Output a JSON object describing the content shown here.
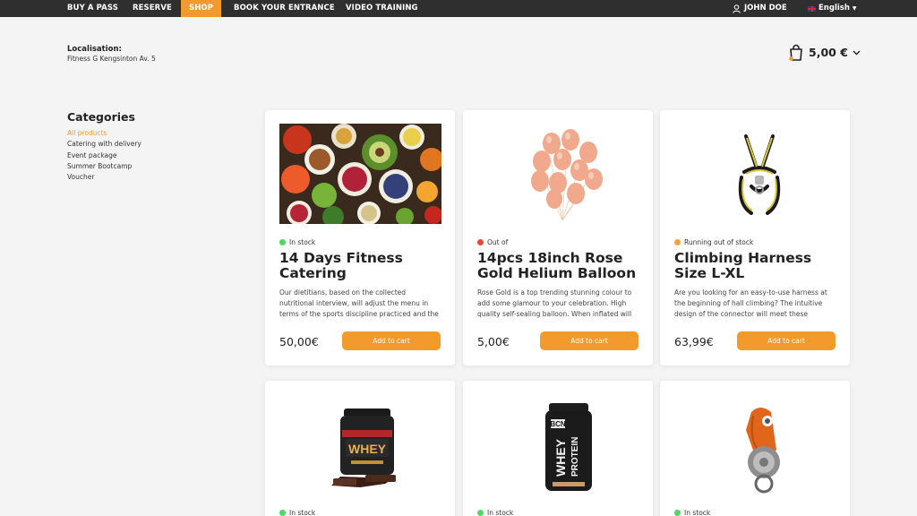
{
  "nav": {
    "items": [
      {
        "label": "BUY A PASS",
        "active": false
      },
      {
        "label": "RESERVE",
        "active": false
      },
      {
        "label": "SHOP",
        "active": true
      },
      {
        "label": "BOOK YOUR ENTRANCE",
        "active": false
      },
      {
        "label": "VIDEO TRAINING",
        "active": false
      }
    ],
    "user": "JOHN DOE",
    "language": "English"
  },
  "localisation": {
    "label": "Localisation:",
    "value": "Fitness G Kengsinton Av. 5"
  },
  "cart": {
    "total": "5,00 €",
    "icon": "shopping-bag-icon"
  },
  "categories": {
    "title": "Categories",
    "items": [
      {
        "label": "All products",
        "active": true
      },
      {
        "label": "Catering with delivery",
        "active": false
      },
      {
        "label": "Event package",
        "active": false
      },
      {
        "label": "Summer Bootcamp",
        "active": false
      },
      {
        "label": "Voucher",
        "active": false
      }
    ]
  },
  "colors": {
    "accent": "#f39a2c",
    "nav_bg": "#2f2f2f",
    "in_stock": "#4cd964",
    "out_of_stock": "#e8473e",
    "running_out": "#f3a23c"
  },
  "products": [
    {
      "stock": "In stock",
      "stock_state": "green",
      "title": "14 Days Fitness Catering",
      "description": "Our dietitians, based on the collected nutritional interview, will adjust the menu in terms of the sports discipline practiced and the needs.",
      "price": "50,00€",
      "button": "Add to cart",
      "image": "healthy-food-image"
    },
    {
      "stock": "Out of",
      "stock_state": "red",
      "title": "14pcs 18inch Rose Gold Helium Balloon",
      "description": "Rose Gold is a top trending stunning colour to add some glamour to your celebration. High quality self-sealing balloon. When inflated  will float for",
      "price": "5,00€",
      "button": "Add to cart",
      "image": "balloons-image"
    },
    {
      "stock": "Running out of stock",
      "stock_state": "orange",
      "title": "Climbing Harness Size L-XL",
      "description": "Are you looking for an easy-to-use harness at the beginning of hall climbing? The intuitive design of the connector will meet these solutions.",
      "price": "63,99€",
      "button": "Add to cart",
      "image": "climbing-harness-image"
    },
    {
      "stock": "In stock",
      "stock_state": "green",
      "image": "whey-protein-tub-image"
    },
    {
      "stock": "In stock",
      "stock_state": "green",
      "image": "bcn-whey-protein-image"
    },
    {
      "stock": "In stock",
      "stock_state": "green",
      "image": "climbing-pulley-image"
    }
  ]
}
